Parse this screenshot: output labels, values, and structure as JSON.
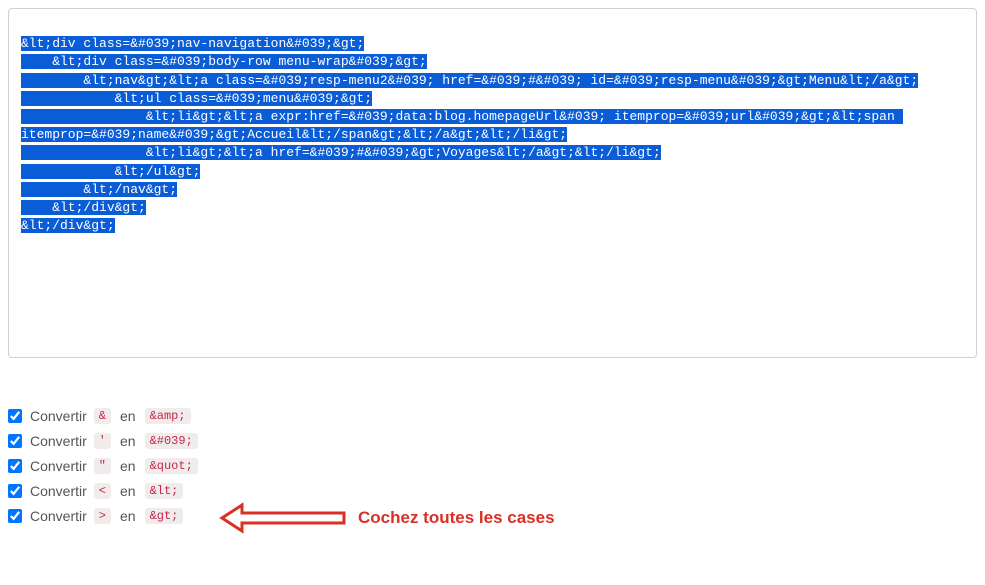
{
  "code": {
    "line1": "&lt;div class=&#039;nav-navigation&#039;&gt;",
    "line2": "    &lt;div class=&#039;body-row menu-wrap&#039;&gt;",
    "line3": "        &lt;nav&gt;&lt;a class=&#039;resp-menu2&#039; href=&#039;#&#039; id=&#039;resp-menu&#039;&gt;Menu&lt;/a&gt;",
    "line4": "            &lt;ul class=&#039;menu&#039;&gt;",
    "line5_a": "                &lt;li&gt;&lt;a expr:href=&#039;data:blog.homepageUrl&#039; itemprop=&#039;url&#039;&gt;&lt;span ",
    "line5_b": "itemprop=&#039;name&#039;&gt;Accueil&lt;/span&gt;&lt;/a&gt;&lt;/li&gt;",
    "line6": "                &lt;li&gt;&lt;a href=&#039;#&#039;&gt;Voyages&lt;/a&gt;&lt;/li&gt;",
    "line7": "            &lt;/ul&gt;",
    "line8": "        &lt;/nav&gt;",
    "line9": "    &lt;/div&gt;",
    "line10": "&lt;/div&gt;"
  },
  "options": {
    "convert_label": "Convertir",
    "to_label": "en",
    "rows": [
      {
        "from": "&",
        "to": "&amp;"
      },
      {
        "from": "'",
        "to": "&#039;"
      },
      {
        "from": "\"",
        "to": "&quot;"
      },
      {
        "from": "<",
        "to": "&lt;"
      },
      {
        "from": ">",
        "to": "&gt;"
      }
    ]
  },
  "annotation": {
    "text": "Cochez toutes les cases"
  },
  "colors": {
    "selection_bg": "#0a5dd7",
    "token_fg": "#c7254e",
    "annotation": "#d93025"
  }
}
